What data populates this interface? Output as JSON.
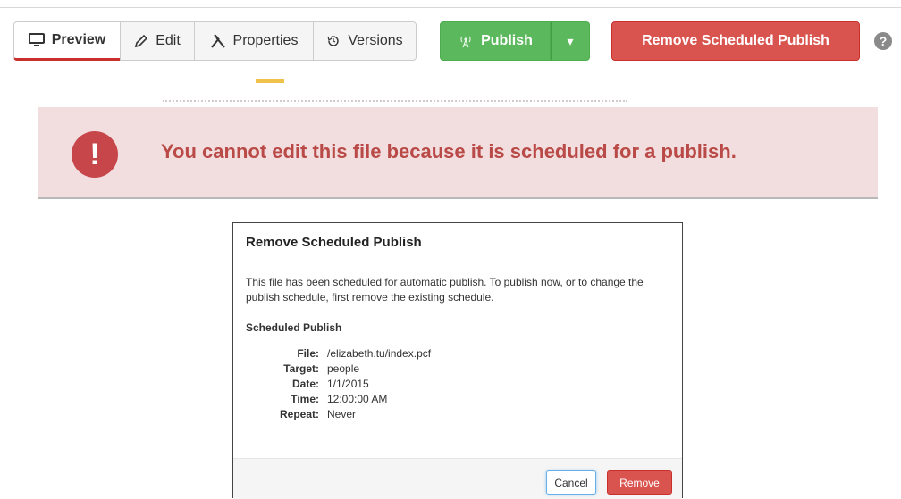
{
  "toolbar": {
    "preview_label": "Preview",
    "edit_label": "Edit",
    "properties_label": "Properties",
    "versions_label": "Versions",
    "publish_label": "Publish",
    "remove_scheduled_label": "Remove Scheduled Publish",
    "help_glyph": "?",
    "icons": {
      "preview": "monitor-icon",
      "edit": "pencil-icon",
      "properties": "wrench-icon",
      "versions": "history-icon",
      "publish": "broadcast-icon",
      "dropdown": "caret-down-icon",
      "help": "help-circle-icon"
    }
  },
  "alert": {
    "message": "You cannot edit this file because it is scheduled for a publish.",
    "icon": "exclamation-circle-icon",
    "glyph": "!"
  },
  "modal": {
    "title": "Remove Scheduled Publish",
    "description": "This file has been scheduled for automatic publish. To publish now, or to change the publish schedule, first remove the existing schedule.",
    "section_title": "Scheduled Publish",
    "details": [
      {
        "label": "File:",
        "value": "/elizabeth.tu/index.pcf"
      },
      {
        "label": "Target:",
        "value": "people"
      },
      {
        "label": "Date:",
        "value": "1/1/2015"
      },
      {
        "label": "Time:",
        "value": "12:00:00 AM"
      },
      {
        "label": "Repeat:",
        "value": "Never"
      }
    ],
    "cancel_label": "Cancel",
    "remove_label": "Remove"
  },
  "colors": {
    "publish_green": "#5cb85c",
    "danger_red": "#d9534f",
    "alert_bg": "#f2dede",
    "alert_text": "#b94a48"
  }
}
